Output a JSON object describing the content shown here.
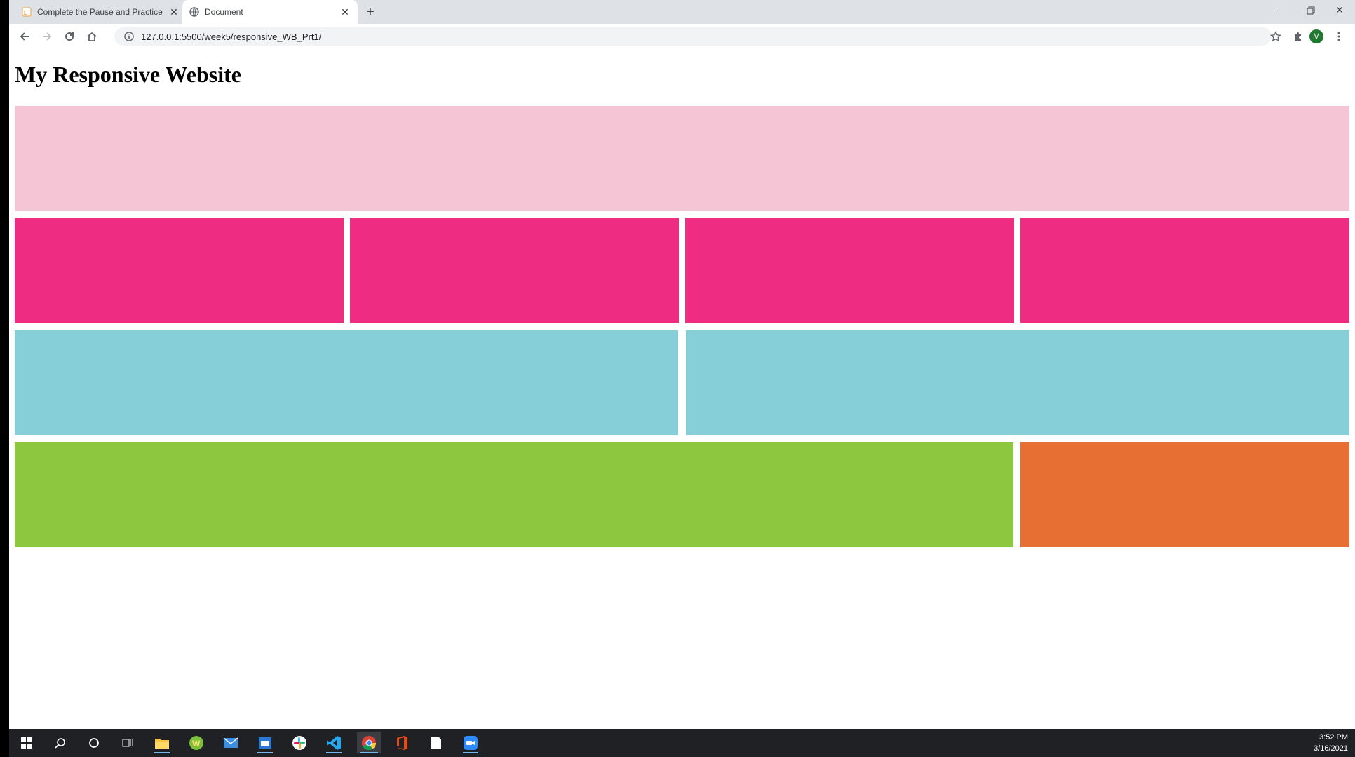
{
  "browser": {
    "tabs": [
      {
        "title": "Complete the Pause and Practice",
        "active": false
      },
      {
        "title": "Document",
        "active": true
      }
    ],
    "new_tab_label": "+",
    "url": "127.0.0.1:5500/week5/responsive_WB_Prt1/",
    "profile_initial": "M"
  },
  "page": {
    "heading": "My Responsive Website",
    "rows": [
      {
        "boxes": 1,
        "color": "#f5c5d5"
      },
      {
        "boxes": 4,
        "color": "#ee2d82"
      },
      {
        "boxes": 2,
        "color": "#86ced8"
      },
      {
        "boxes": 2,
        "colors": [
          "#8dc63f",
          "#e86f34"
        ]
      }
    ]
  },
  "taskbar": {
    "apps": [
      "windows-start-icon",
      "search-icon",
      "cortana-icon",
      "task-view-icon",
      "file-explorer-icon",
      "webex-icon",
      "mail-icon",
      "calendar-icon",
      "slack-icon",
      "vscode-icon",
      "chrome-icon",
      "office-icon",
      "notepad-icon",
      "zoom-icon"
    ],
    "time": "3:52 PM",
    "date": "3/16/2021"
  }
}
